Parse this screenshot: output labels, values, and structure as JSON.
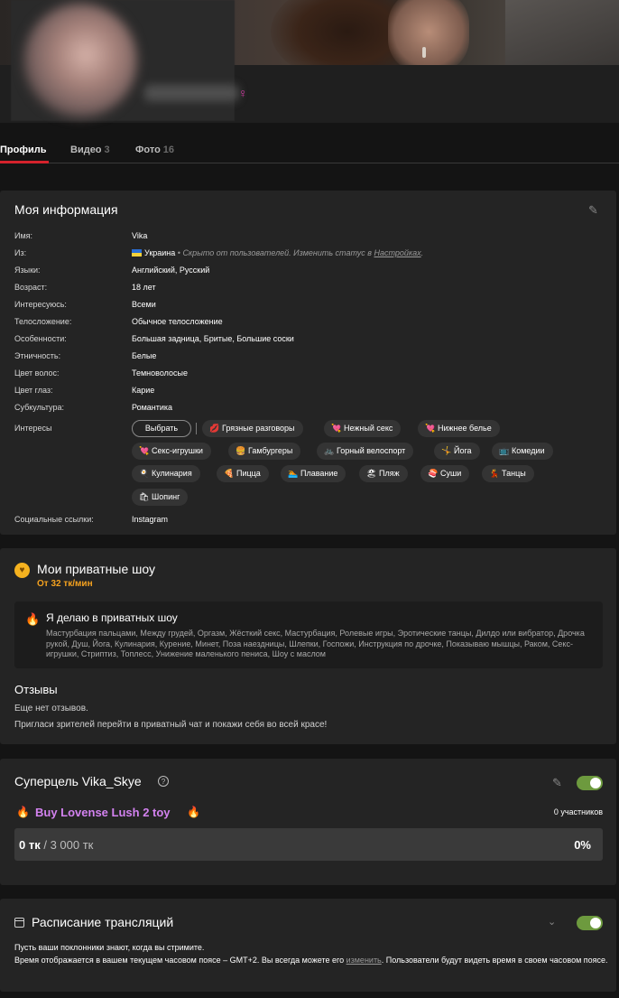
{
  "profile": {
    "gender_icon": "female-icon"
  },
  "tabs": [
    {
      "label": "Профиль",
      "count": ""
    },
    {
      "label": "Видео",
      "count": "3"
    },
    {
      "label": "Фото",
      "count": "16"
    }
  ],
  "info": {
    "title": "Моя информация",
    "rows": [
      {
        "label": "Имя:",
        "value": "Vika"
      },
      {
        "label": "Из:",
        "value": "Украина"
      },
      {
        "label": "Языки:",
        "value": "Английский, Русский"
      },
      {
        "label": "Возраст:",
        "value": "18 лет"
      },
      {
        "label": "Интересуюсь:",
        "value": "Всеми"
      },
      {
        "label": "Телосложение:",
        "value": "Обычное телосложение"
      },
      {
        "label": "Особенности:",
        "value": "Большая задница, Бритые, Большие соски"
      },
      {
        "label": "Этничность:",
        "value": "Белые"
      },
      {
        "label": "Цвет волос:",
        "value": "Темноволосые"
      },
      {
        "label": "Цвет глаз:",
        "value": "Карие"
      },
      {
        "label": "Субкультура:",
        "value": "Романтика"
      },
      {
        "label": "Интересы",
        "value": ""
      },
      {
        "label": "Социальные ссылки:",
        "value": "Instagram"
      }
    ],
    "location_note_prefix": "Скрыто от пользователей. Изменить статус в",
    "location_note_link": "Настройках",
    "location_note_suffix": ".",
    "choose_label": "Выбрать",
    "interests": [
      {
        "label": "Грязные разговоры",
        "icon": "💋"
      },
      {
        "label": "Нежный секс",
        "icon": "💘"
      },
      {
        "label": "Нижнее белье",
        "icon": "💘"
      },
      {
        "label": "Секс-игрушки",
        "icon": "💘"
      },
      {
        "label": "Гамбургеры",
        "icon": "🍔"
      },
      {
        "label": "Горный велоспорт",
        "icon": "🚲"
      },
      {
        "label": "Йога",
        "icon": "🤸"
      },
      {
        "label": "Комедии",
        "icon": "📺"
      },
      {
        "label": "Кулинария",
        "icon": "🍳"
      },
      {
        "label": "Пицца",
        "icon": "🍕"
      },
      {
        "label": "Плавание",
        "icon": "🏊"
      },
      {
        "label": "Пляж",
        "icon": "🏖"
      },
      {
        "label": "Суши",
        "icon": "🍣"
      },
      {
        "label": "Танцы",
        "icon": "💃"
      },
      {
        "label": "Шопинг",
        "icon": "🛍"
      }
    ]
  },
  "shows": {
    "title": "Мои приватные шоу",
    "price": "От 32 тк/мин",
    "do_title": "Я делаю в приватных шоу",
    "do_list": "Мастурбация пальцами, Между грудей, Оргазм, Жёсткий секс, Мастурбация, Ролевые игры, Эротические танцы, Дилдо или вибратор, Дрочка рукой, Душ, Йога, Кулинария, Курение, Минет, Поза наездницы, Шлепки, Госпожи, Инструкция по дрочке, Показываю мышцы, Раком, Секс-игрушки, Стриптиз, Топлесс, Унижение маленького пениса, Шоу с маслом",
    "reviews_title": "Отзывы",
    "no_reviews": "Еще нет отзывов.",
    "invite": "Пригласи зрителей перейти в приватный чат и покажи себя во всей красе!"
  },
  "goal": {
    "title": "Суперцель Vika_Skye",
    "name": "Buy Lovense Lush 2 toy",
    "participants": "0 участников",
    "current": "0 тк",
    "target": "/ 3 000 тк",
    "percent": "0%",
    "progress_fraction": 0,
    "enabled": true
  },
  "schedule": {
    "title": "Расписание трансляций",
    "line1": "Пусть ваши поклонники знают, когда вы стримите.",
    "line2_prefix": "Время отображается в вашем текущем часовом поясе – GMT+2. Вы всегда можете его",
    "line2_link": "изменить",
    "line2_suffix": ". Пользователи будут видеть время в своем часовом поясе.",
    "enabled": true
  },
  "colors": {
    "accent_red": "#d5222c",
    "price_orange": "#f5a21f",
    "goal_purple": "#d382f0",
    "toggle_green": "#6d9a3e"
  }
}
